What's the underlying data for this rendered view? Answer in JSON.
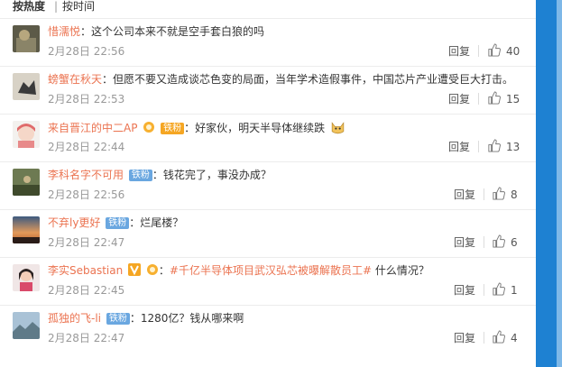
{
  "sort": {
    "hot": "按热度",
    "separator": "|",
    "time": "按时间"
  },
  "comments": [
    {
      "user": "惜濡悦",
      "text": "：这个公司本来不就是空手套白狼的吗",
      "date": "2月28日 22:56",
      "reply": "回复",
      "likes": "40"
    },
    {
      "user": "螃蟹在秋天",
      "text": "：但愿不要又造成谈芯色变的局面，当年学术造假事件，中国芯片产业遭受巨大打击。",
      "date": "2月28日 22:53",
      "reply": "回复",
      "likes": "15"
    },
    {
      "user": "来自晋江的中二AP",
      "badge_text": "铁粉",
      "text": "：好家伙，明天半导体继续跌",
      "date": "2月28日 22:44",
      "reply": "回复",
      "likes": "13"
    },
    {
      "user": "李科名字不可用",
      "badge_text": "铁粉",
      "text": "：钱花完了，事没办成？",
      "date": "2月28日 22:56",
      "reply": "回复",
      "likes": "8"
    },
    {
      "user": "不弃ly更好",
      "badge_text": "铁粉",
      "text": "：烂尾楼？",
      "date": "2月28日 22:47",
      "reply": "回复",
      "likes": "6"
    },
    {
      "user": "李实Sebastian",
      "topic": "#千亿半导体项目武汉弘芯被曝解散员工#",
      "text": "：",
      "text2": " 什么情况？",
      "date": "2月28日 22:45",
      "reply": "回复",
      "likes": "1"
    },
    {
      "user": "孤独的飞-li",
      "badge_text": "铁粉",
      "text": "：1280亿？钱从哪来啊",
      "date": "2月28日 22:47",
      "reply": "回复",
      "likes": "4"
    }
  ],
  "colors": {
    "username": "#eb7350",
    "badge": "#6aa7e0",
    "sidebar": "#1e81d2"
  }
}
